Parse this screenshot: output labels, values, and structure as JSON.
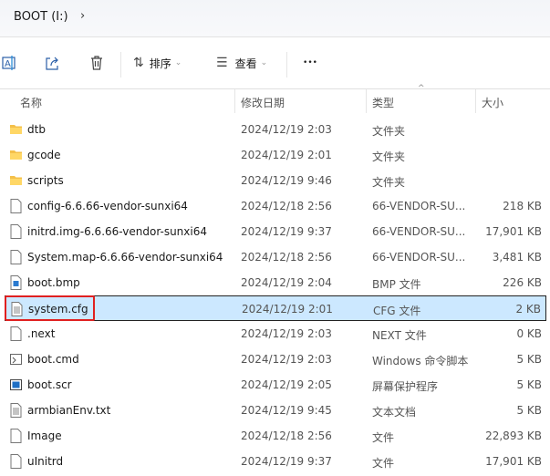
{
  "address": {
    "crumb": "BOOT (I:)",
    "chevron": "›"
  },
  "toolbar": {
    "sort_label": "排序",
    "view_label": "查看",
    "more": "•••",
    "dropdown": "⌄"
  },
  "columns": {
    "name": "名称",
    "date": "修改日期",
    "type": "类型",
    "size": "大小"
  },
  "files": [
    {
      "name": "dtb",
      "date": "2024/12/19 2:03",
      "type": "文件夹",
      "size": "",
      "icon": "folder"
    },
    {
      "name": "gcode",
      "date": "2024/12/19 2:01",
      "type": "文件夹",
      "size": "",
      "icon": "folder"
    },
    {
      "name": "scripts",
      "date": "2024/12/19 9:46",
      "type": "文件夹",
      "size": "",
      "icon": "folder"
    },
    {
      "name": "config-6.6.66-vendor-sunxi64",
      "date": "2024/12/18 2:56",
      "type": "66-VENDOR-SU...",
      "size": "218 KB",
      "icon": "file"
    },
    {
      "name": "initrd.img-6.6.66-vendor-sunxi64",
      "date": "2024/12/19 9:37",
      "type": "66-VENDOR-SU...",
      "size": "17,901 KB",
      "icon": "file"
    },
    {
      "name": "System.map-6.6.66-vendor-sunxi64",
      "date": "2024/12/18 2:56",
      "type": "66-VENDOR-SU...",
      "size": "3,481 KB",
      "icon": "file"
    },
    {
      "name": "boot.bmp",
      "date": "2024/12/19 2:04",
      "type": "BMP 文件",
      "size": "226 KB",
      "icon": "image"
    },
    {
      "name": "system.cfg",
      "date": "2024/12/19 2:01",
      "type": "CFG 文件",
      "size": "2 KB",
      "icon": "text"
    },
    {
      "name": ".next",
      "date": "2024/12/19 2:03",
      "type": "NEXT 文件",
      "size": "0 KB",
      "icon": "file"
    },
    {
      "name": "boot.cmd",
      "date": "2024/12/19 2:03",
      "type": "Windows 命令脚本",
      "size": "5 KB",
      "icon": "script"
    },
    {
      "name": "boot.scr",
      "date": "2024/12/19 2:05",
      "type": "屏幕保护程序",
      "size": "5 KB",
      "icon": "screensaver"
    },
    {
      "name": "armbianEnv.txt",
      "date": "2024/12/19 9:45",
      "type": "文本文档",
      "size": "5 KB",
      "icon": "text"
    },
    {
      "name": "Image",
      "date": "2024/12/18 2:56",
      "type": "文件",
      "size": "22,893 KB",
      "icon": "file"
    },
    {
      "name": "uInitrd",
      "date": "2024/12/19 9:37",
      "type": "文件",
      "size": "17,901 KB",
      "icon": "file"
    }
  ],
  "selected_index": 7
}
